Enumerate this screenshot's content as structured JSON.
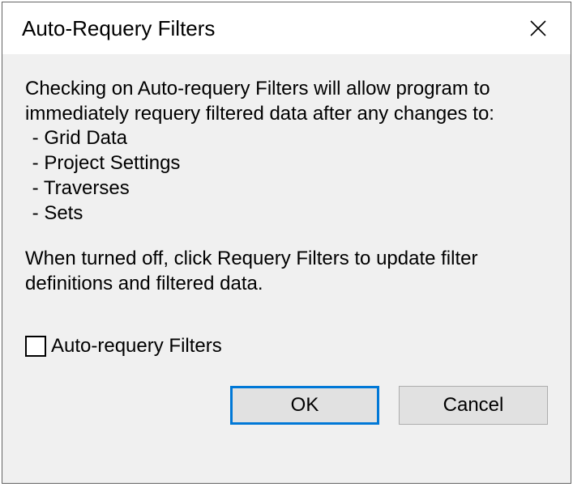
{
  "dialog": {
    "title": "Auto-Requery Filters",
    "intro": "Checking on Auto-requery Filters will allow program to immediately requery filtered data after any changes to:",
    "bullets": [
      "Grid Data",
      "Project Settings",
      "Traverses",
      "Sets"
    ],
    "off_note": "When turned off, click Requery Filters to update filter definitions and filtered data.",
    "checkbox_label": "Auto-requery Filters",
    "checkbox_checked": false,
    "buttons": {
      "ok": "OK",
      "cancel": "Cancel"
    }
  }
}
